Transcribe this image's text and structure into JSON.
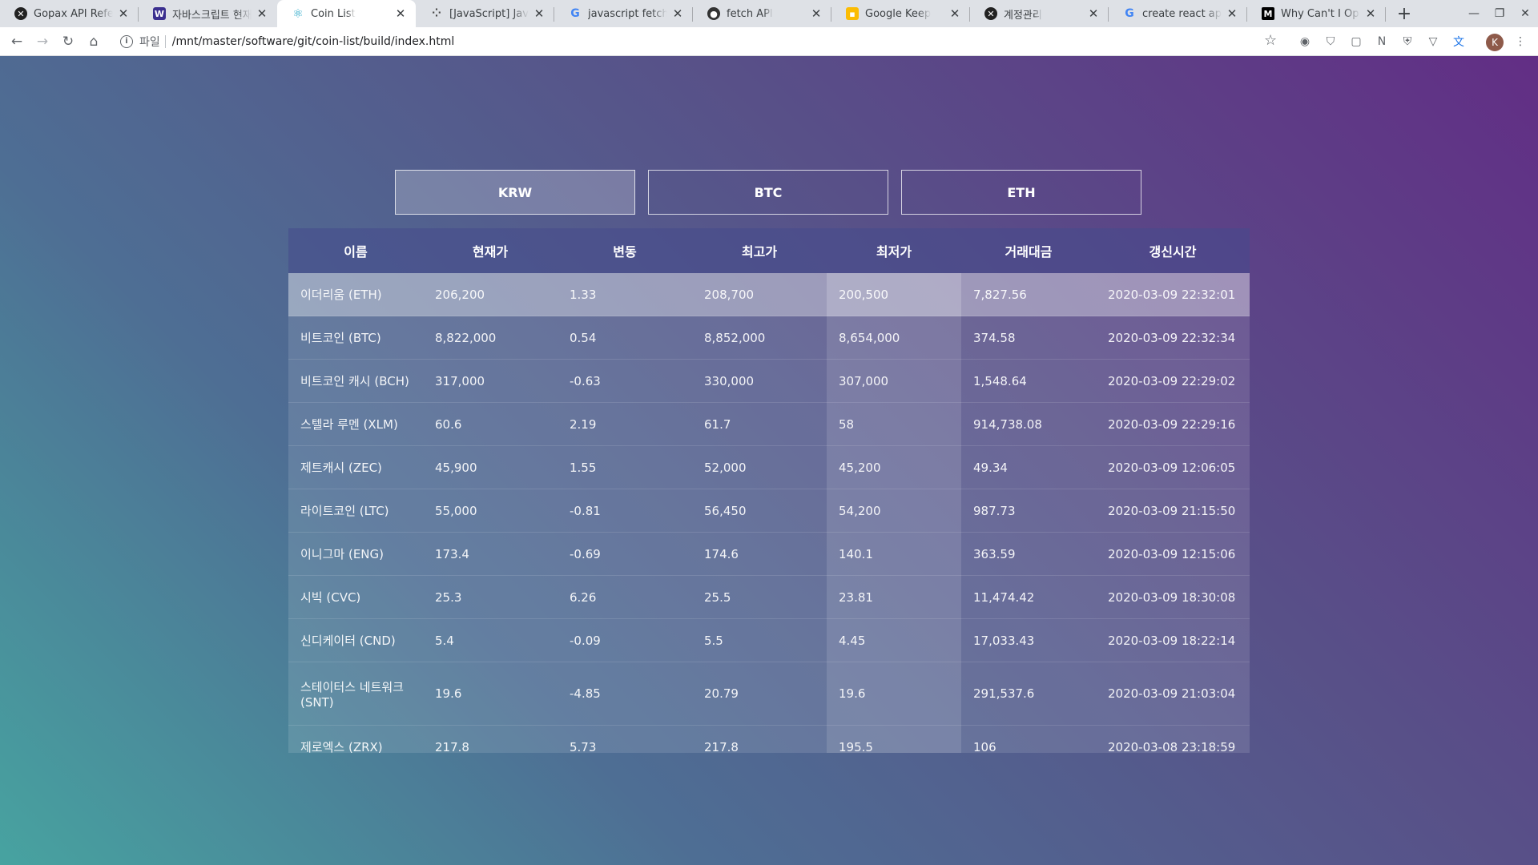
{
  "browser": {
    "tabs": [
      {
        "title": "Gopax API Reference",
        "favicon": "x-circle-icon",
        "color": "#222222"
      },
      {
        "title": "자바스크립트 현재 시간",
        "favicon": "w-logo-icon",
        "color": "#3b2f8f"
      },
      {
        "title": "Coin List",
        "favicon": "react-icon",
        "color": "#61dafb"
      },
      {
        "title": "[JavaScript] JavaScript",
        "favicon": "dots-icon",
        "color": "#444444"
      },
      {
        "title": "javascript fetch sign",
        "favicon": "google-icon",
        "color": "#4285f4"
      },
      {
        "title": "fetch API",
        "favicon": "github-icon",
        "color": "#333333"
      },
      {
        "title": "Google Keep",
        "favicon": "keep-icon",
        "color": "#fbbc04"
      },
      {
        "title": "계정관리",
        "favicon": "x-circle-icon",
        "color": "#222222"
      },
      {
        "title": "create react app build",
        "favicon": "google-icon",
        "color": "#4285f4"
      },
      {
        "title": "Why Can't I Open",
        "favicon": "medium-icon",
        "color": "#000000"
      }
    ],
    "address_scheme": "파일",
    "address_url": "/mnt/master/software/git/coin-list/build/index.html",
    "avatar_letter": "K"
  },
  "currency_tabs": [
    {
      "label": "KRW",
      "selected": true
    },
    {
      "label": "BTC",
      "selected": false
    },
    {
      "label": "ETH",
      "selected": false
    }
  ],
  "table": {
    "headers": [
      "이름",
      "현재가",
      "변동",
      "최고가",
      "최저가",
      "거래대금",
      "갱신시간"
    ],
    "rows": [
      [
        "이더리움 (ETH)",
        "206,200",
        "1.33",
        "208,700",
        "200,500",
        "7,827.56",
        "2020-03-09 22:32:01"
      ],
      [
        "비트코인 (BTC)",
        "8,822,000",
        "0.54",
        "8,852,000",
        "8,654,000",
        "374.58",
        "2020-03-09 22:32:34"
      ],
      [
        "비트코인 캐시 (BCH)",
        "317,000",
        "-0.63",
        "330,000",
        "307,000",
        "1,548.64",
        "2020-03-09 22:29:02"
      ],
      [
        "스텔라 루멘 (XLM)",
        "60.6",
        "2.19",
        "61.7",
        "58",
        "914,738.08",
        "2020-03-09 22:29:16"
      ],
      [
        "제트캐시 (ZEC)",
        "45,900",
        "1.55",
        "52,000",
        "45,200",
        "49.34",
        "2020-03-09 12:06:05"
      ],
      [
        "라이트코인 (LTC)",
        "55,000",
        "-0.81",
        "56,450",
        "54,200",
        "987.73",
        "2020-03-09 21:15:50"
      ],
      [
        "이니그마 (ENG)",
        "173.4",
        "-0.69",
        "174.6",
        "140.1",
        "363.59",
        "2020-03-09 12:15:06"
      ],
      [
        "시빅 (CVC)",
        "25.3",
        "6.26",
        "25.5",
        "23.81",
        "11,474.42",
        "2020-03-09 18:30:08"
      ],
      [
        "신디케이터 (CND)",
        "5.4",
        "-0.09",
        "5.5",
        "4.45",
        "17,033.43",
        "2020-03-09 18:22:14"
      ],
      [
        "스테이터스 네트워크 (SNT)",
        "19.6",
        "-4.85",
        "20.79",
        "19.6",
        "291,537.6",
        "2020-03-09 21:03:04"
      ],
      [
        "제로엑스 (ZRX)",
        "217.8",
        "5.73",
        "217.8",
        "195.5",
        "106",
        "2020-03-08 23:18:59"
      ]
    ]
  }
}
